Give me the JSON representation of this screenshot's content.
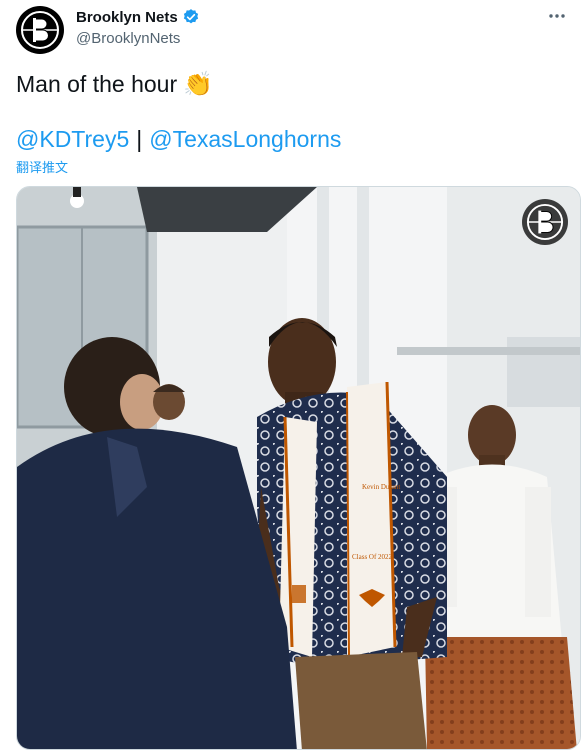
{
  "account": {
    "display_name": "Brooklyn Nets",
    "handle": "@BrooklynNets",
    "verified": true,
    "avatar_icon": "brooklyn-nets-logo-icon"
  },
  "tweet": {
    "text": "Man of the hour",
    "emoji": "👏",
    "mentions": [
      "@KDTrey5",
      "@TexasLonghorns"
    ],
    "separator": "|",
    "translate_label": "翻译推文"
  },
  "media": {
    "type": "video-still",
    "watermark_icon": "brooklyn-nets-logo-icon",
    "stole_text": {
      "name": "Kevin Durant",
      "class": "Class Of 2022"
    }
  },
  "colors": {
    "link": "#1d9bf0",
    "verified": "#1d9bf0",
    "text": "#0f1419",
    "secondary": "#536471",
    "longhorn_orange": "#bf5700"
  }
}
